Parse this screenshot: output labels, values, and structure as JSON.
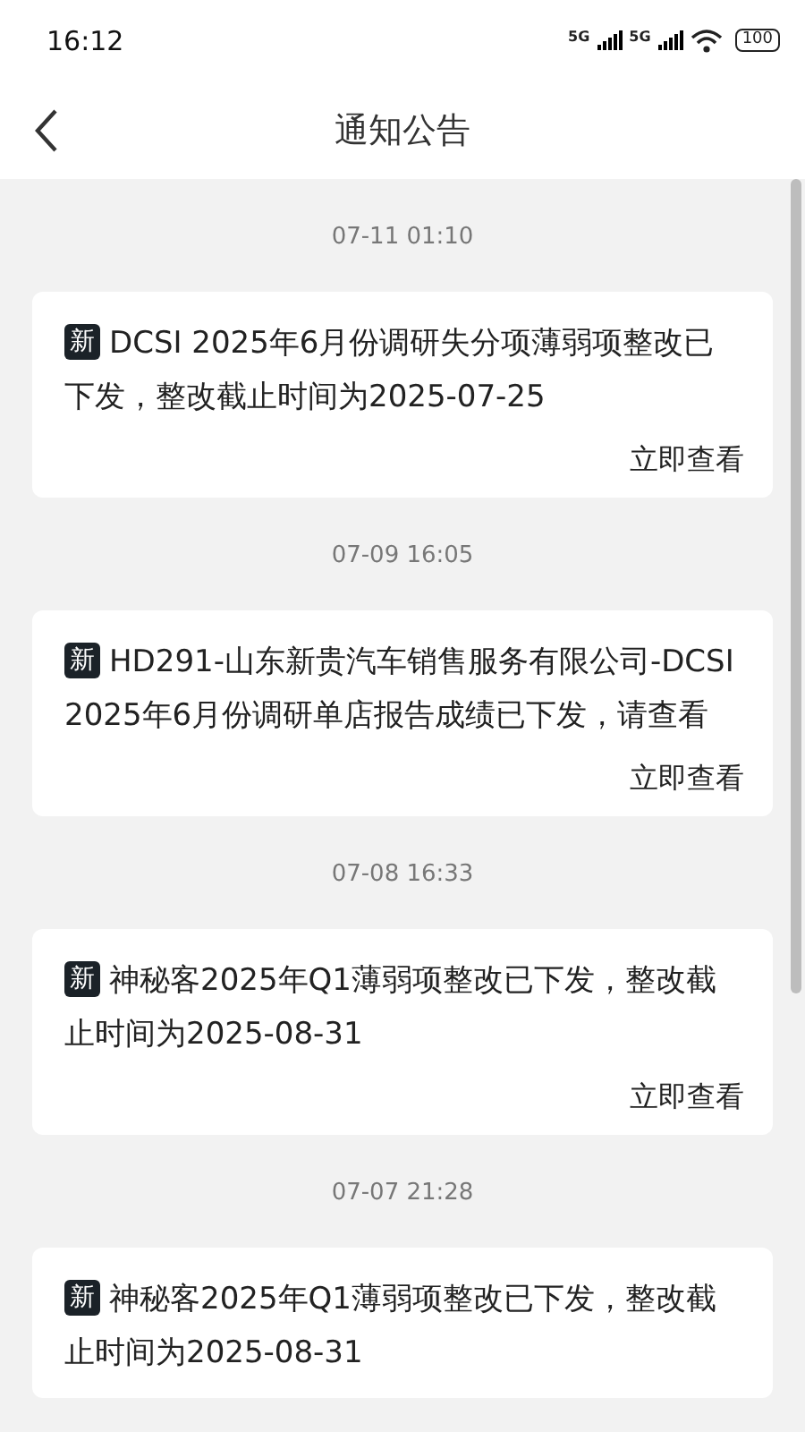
{
  "status_bar": {
    "time": "16:12",
    "network_1": "5G",
    "network_2": "5G",
    "battery": "100"
  },
  "header": {
    "title": "通知公告"
  },
  "notices": [
    {
      "time": "07-11 01:10",
      "badge": "新",
      "title": "DCSI 2025年6月份调研失分项薄弱项整改已下发，整改截止时间为2025-07-25",
      "action": "立即查看"
    },
    {
      "time": "07-09 16:05",
      "badge": "新",
      "title": "HD291-山东新贵汽车销售服务有限公司-DCSI 2025年6月份调研单店报告成绩已下发，请查看",
      "action": "立即查看"
    },
    {
      "time": "07-08 16:33",
      "badge": "新",
      "title": "神秘客2025年Q1薄弱项整改已下发，整改截止时间为2025-08-31",
      "action": "立即查看"
    },
    {
      "time": "07-07 21:28",
      "badge": "新",
      "title": "神秘客2025年Q1薄弱项整改已下发，整改截止时间为2025-08-31"
    }
  ]
}
